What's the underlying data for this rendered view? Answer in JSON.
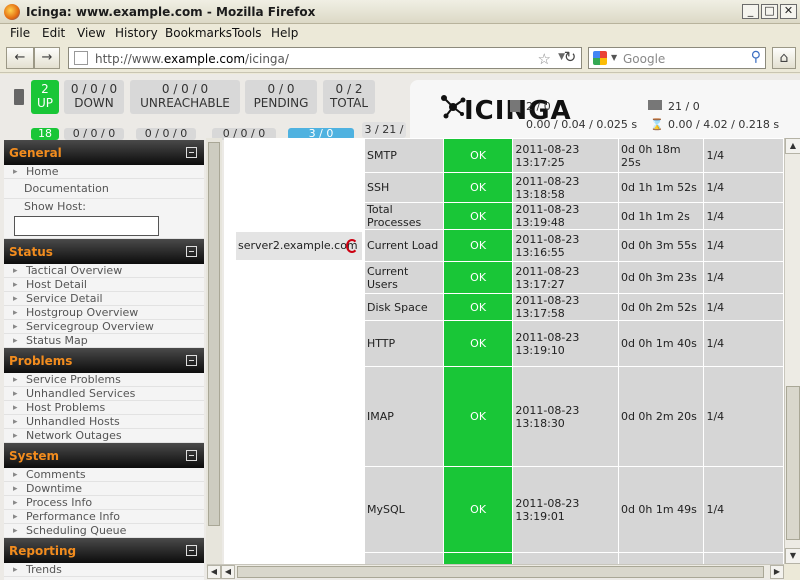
{
  "window": {
    "title": "Icinga: www.example.com - Mozilla Firefox",
    "min": "_",
    "max": "□",
    "close": "✕"
  },
  "menu": [
    "File",
    "Edit",
    "View",
    "History",
    "Bookmarks",
    "Tools",
    "Help"
  ],
  "nav": {
    "back": "←",
    "forward": "→",
    "url_prefix": "http://www.",
    "url_host": "example.com",
    "url_path": "/icinga/",
    "search_placeholder": "Google",
    "reload": "↻",
    "home": "⌂"
  },
  "host_status": [
    {
      "count": "2",
      "label": "UP",
      "color": "#19c637"
    },
    {
      "count": "0 / 0 / 0",
      "label": "DOWN"
    },
    {
      "count": "0 / 0 / 0",
      "label": "UNREACHABLE"
    },
    {
      "count": "0 / 0",
      "label": "PENDING"
    },
    {
      "count": "0 / 2",
      "label": "TOTAL"
    }
  ],
  "service_status": [
    "18",
    "0 / 0 / 0",
    "0 / 0 / 0",
    "0 / 0 / 0",
    "3 / 0",
    "3 / 21 /"
  ],
  "logo": {
    "text": "ICINGA"
  },
  "perf": {
    "hosts_active": "2 / 0",
    "services_active": "21 / 0",
    "hosts_latency": "0.00 / 0.04 / 0.025 s",
    "services_latency": "0.00 / 4.02 / 0.218 s"
  },
  "sidebar": [
    {
      "title": "General",
      "items": [
        "Home",
        "Documentation",
        "Show Host:"
      ]
    },
    {
      "title": "Status",
      "items": [
        "Tactical Overview",
        "Host Detail",
        "Service Detail",
        "Hostgroup Overview",
        "Servicegroup Overview",
        "Status Map"
      ]
    },
    {
      "title": "Problems",
      "items": [
        "Service Problems",
        "Unhandled Services",
        "Host Problems",
        "Unhandled Hosts",
        "Network Outages"
      ]
    },
    {
      "title": "System",
      "items": [
        "Comments",
        "Downtime",
        "Process Info",
        "Performance Info",
        "Scheduling Queue"
      ]
    },
    {
      "title": "Reporting",
      "items": [
        "Trends"
      ]
    }
  ],
  "host_name": "server2.example.com",
  "services": [
    {
      "name": "SMTP",
      "status": "OK",
      "last_check": "2011-08-23 13:17:25",
      "duration": "0d 0h 18m 25s",
      "attempt": "1/4"
    },
    {
      "name": "SSH",
      "status": "OK",
      "last_check": "2011-08-23 13:18:58",
      "duration": "0d 1h 1m 52s",
      "attempt": "1/4"
    },
    {
      "name": "Total Processes",
      "status": "OK",
      "last_check": "2011-08-23 13:19:48",
      "duration": "0d 1h 1m 2s",
      "attempt": "1/4"
    },
    {
      "name": "Current Load",
      "status": "OK",
      "last_check": "2011-08-23 13:16:55",
      "duration": "0d 0h 3m 55s",
      "attempt": "1/4"
    },
    {
      "name": "Current Users",
      "status": "OK",
      "last_check": "2011-08-23 13:17:27",
      "duration": "0d 0h 3m 23s",
      "attempt": "1/4"
    },
    {
      "name": "Disk Space",
      "status": "OK",
      "last_check": "2011-08-23 13:17:58",
      "duration": "0d 0h 2m 52s",
      "attempt": "1/4"
    },
    {
      "name": "HTTP",
      "status": "OK",
      "last_check": "2011-08-23 13:19:10",
      "duration": "0d 0h 1m 40s",
      "attempt": "1/4"
    },
    {
      "name": "IMAP",
      "status": "OK",
      "last_check": "2011-08-23 13:18:30",
      "duration": "0d 0h 2m 20s",
      "attempt": "1/4"
    },
    {
      "name": "MySQL",
      "status": "OK",
      "last_check": "2011-08-23 13:19:01",
      "duration": "0d 0h 1m 49s",
      "attempt": "1/4"
    },
    {
      "name": "",
      "status": "",
      "last_check": "",
      "duration": "",
      "attempt": ""
    }
  ]
}
